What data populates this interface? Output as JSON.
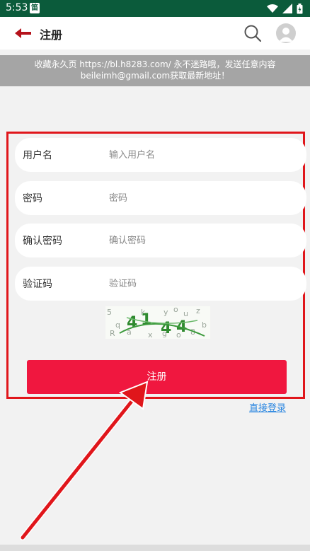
{
  "status_bar": {
    "time": "5:53",
    "app_icon_text": "笛"
  },
  "header": {
    "title": "注册"
  },
  "notice": {
    "line1": "收藏永久页 https://bl.h8283.com/ 永不迷路哦，发送任意内容",
    "line2": "beileimh@gmail.com获取最新地址！"
  },
  "form": {
    "username": {
      "label": "用户名",
      "placeholder": "输入用户名"
    },
    "password": {
      "label": "密码",
      "placeholder": "密码"
    },
    "confirm": {
      "label": "确认密码",
      "placeholder": "确认密码"
    },
    "captcha": {
      "label": "验证码",
      "placeholder": "验证码"
    },
    "submit_label": "注册"
  },
  "login_link": "直接登录",
  "colors": {
    "status_bar": "#0b5b3b",
    "primary": "#f0173f",
    "highlight_border": "#e0161b",
    "link": "#2a86e0"
  }
}
